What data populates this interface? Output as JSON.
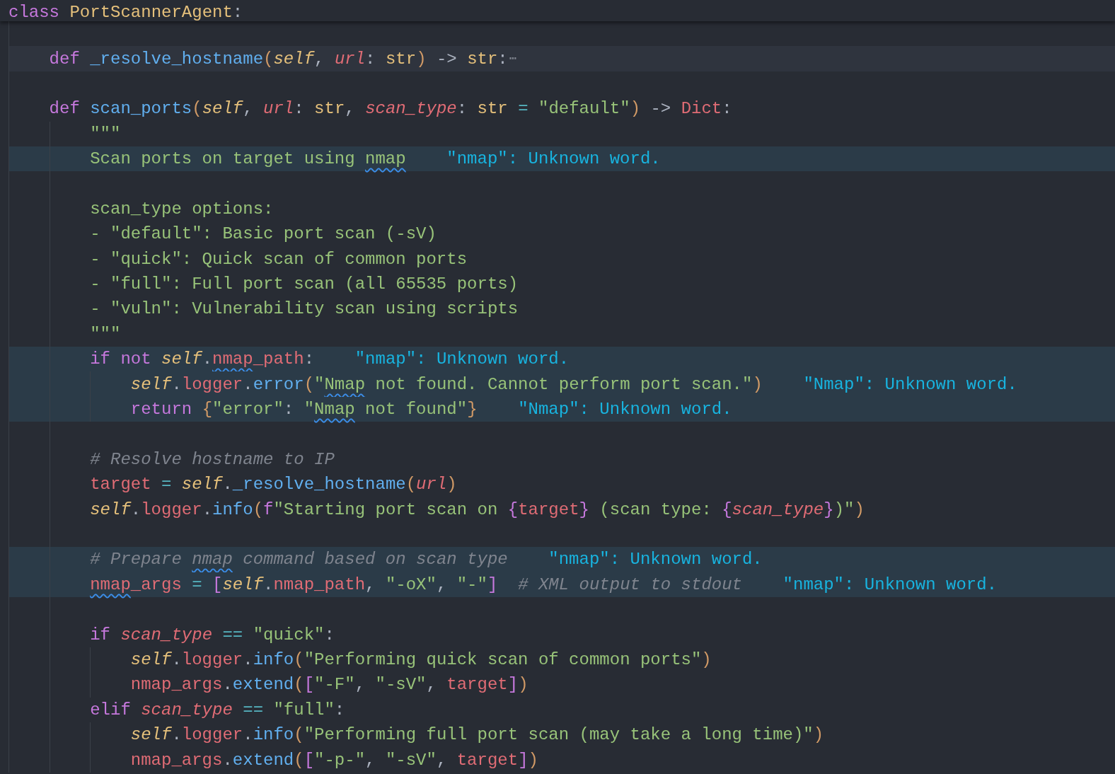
{
  "sticky_header": {
    "tokens": [
      {
        "text": "class ",
        "kind": "kw"
      },
      {
        "text": "PortScannerAgent",
        "kind": "type"
      },
      {
        "text": ":",
        "kind": "punct"
      }
    ]
  },
  "lines": [
    {
      "kind": "blank"
    },
    {
      "kind": "code",
      "folded": true,
      "tokens": [
        {
          "text": "def ",
          "kind": "kw"
        },
        {
          "text": "_resolve_hostname",
          "kind": "fn"
        },
        {
          "text": "(",
          "kind": "p1"
        },
        {
          "text": "self",
          "kind": "self"
        },
        {
          "text": ", ",
          "kind": "punct"
        },
        {
          "text": "url",
          "kind": "param"
        },
        {
          "text": ": ",
          "kind": "punct"
        },
        {
          "text": "str",
          "kind": "type"
        },
        {
          "text": ")",
          "kind": "p1"
        },
        {
          "text": " -> ",
          "kind": "punct"
        },
        {
          "text": "str",
          "kind": "type"
        },
        {
          "text": ":",
          "kind": "punct"
        }
      ],
      "fold_marker": "⋯"
    },
    {
      "kind": "blank"
    },
    {
      "kind": "code",
      "tokens": [
        {
          "text": "def ",
          "kind": "kw"
        },
        {
          "text": "scan_ports",
          "kind": "fn"
        },
        {
          "text": "(",
          "kind": "p1"
        },
        {
          "text": "self",
          "kind": "self"
        },
        {
          "text": ", ",
          "kind": "punct"
        },
        {
          "text": "url",
          "kind": "param"
        },
        {
          "text": ": ",
          "kind": "punct"
        },
        {
          "text": "str",
          "kind": "type"
        },
        {
          "text": ", ",
          "kind": "punct"
        },
        {
          "text": "scan_type",
          "kind": "param"
        },
        {
          "text": ": ",
          "kind": "punct"
        },
        {
          "text": "str",
          "kind": "type"
        },
        {
          "text": " = ",
          "kind": "op"
        },
        {
          "text": "\"default\"",
          "kind": "str"
        },
        {
          "text": ")",
          "kind": "p1"
        },
        {
          "text": " -> ",
          "kind": "punct"
        },
        {
          "text": "Dict",
          "kind": "var"
        },
        {
          "text": ":",
          "kind": "punct"
        }
      ],
      "children": [
        {
          "kind": "code",
          "tokens": [
            {
              "text": "\"\"\"",
              "kind": "str"
            }
          ]
        },
        {
          "kind": "code",
          "tokens": [
            {
              "text": "Scan ports on target using ",
              "kind": "str"
            },
            {
              "text": "nmap",
              "kind": "str",
              "misspelled": true
            }
          ],
          "diagnostic": "\"nmap\": Unknown word."
        },
        {
          "kind": "blank"
        },
        {
          "kind": "code",
          "tokens": [
            {
              "text": "scan_type options:",
              "kind": "str"
            }
          ]
        },
        {
          "kind": "code",
          "tokens": [
            {
              "text": "- \"default\": Basic port scan (-sV)",
              "kind": "str"
            }
          ]
        },
        {
          "kind": "code",
          "tokens": [
            {
              "text": "- \"quick\": Quick scan of common ports",
              "kind": "str"
            }
          ]
        },
        {
          "kind": "code",
          "tokens": [
            {
              "text": "- \"full\": Full port scan (all 65535 ports)",
              "kind": "str"
            }
          ]
        },
        {
          "kind": "code",
          "tokens": [
            {
              "text": "- \"vuln\": Vulnerability scan using scripts",
              "kind": "str"
            }
          ]
        },
        {
          "kind": "code",
          "tokens": [
            {
              "text": "\"\"\"",
              "kind": "str"
            }
          ]
        },
        {
          "kind": "code",
          "tokens": [
            {
              "text": "if ",
              "kind": "kw"
            },
            {
              "text": "not ",
              "kind": "kw"
            },
            {
              "text": "self",
              "kind": "self"
            },
            {
              "text": ".",
              "kind": "punct"
            },
            {
              "text": "nmap",
              "kind": "var",
              "misspelled": true
            },
            {
              "text": "_path",
              "kind": "var"
            },
            {
              "text": ":",
              "kind": "punct"
            }
          ],
          "diagnostic": "\"nmap\": Unknown word.",
          "children": [
            {
              "kind": "code",
              "tokens": [
                {
                  "text": "self",
                  "kind": "self"
                },
                {
                  "text": ".",
                  "kind": "punct"
                },
                {
                  "text": "logger",
                  "kind": "var"
                },
                {
                  "text": ".",
                  "kind": "punct"
                },
                {
                  "text": "error",
                  "kind": "fn"
                },
                {
                  "text": "(",
                  "kind": "p1"
                },
                {
                  "text": "\"",
                  "kind": "str"
                },
                {
                  "text": "Nmap",
                  "kind": "str",
                  "misspelled": true
                },
                {
                  "text": " not found. Cannot perform port scan.\"",
                  "kind": "str"
                },
                {
                  "text": ")",
                  "kind": "p1"
                }
              ],
              "diagnostic": "\"Nmap\": Unknown word."
            },
            {
              "kind": "code",
              "tokens": [
                {
                  "text": "return ",
                  "kind": "kw"
                },
                {
                  "text": "{",
                  "kind": "p1"
                },
                {
                  "text": "\"error\"",
                  "kind": "str"
                },
                {
                  "text": ": ",
                  "kind": "punct"
                },
                {
                  "text": "\"",
                  "kind": "str"
                },
                {
                  "text": "Nmap",
                  "kind": "str",
                  "misspelled": true
                },
                {
                  "text": " not found\"",
                  "kind": "str"
                },
                {
                  "text": "}",
                  "kind": "p1"
                }
              ],
              "diagnostic": "\"Nmap\": Unknown word."
            }
          ]
        },
        {
          "kind": "blank"
        },
        {
          "kind": "code",
          "tokens": [
            {
              "text": "# Resolve hostname to IP",
              "kind": "comment"
            }
          ]
        },
        {
          "kind": "code",
          "tokens": [
            {
              "text": "target",
              "kind": "var"
            },
            {
              "text": " = ",
              "kind": "op"
            },
            {
              "text": "self",
              "kind": "self"
            },
            {
              "text": ".",
              "kind": "punct"
            },
            {
              "text": "_resolve_hostname",
              "kind": "fn"
            },
            {
              "text": "(",
              "kind": "p1"
            },
            {
              "text": "url",
              "kind": "param"
            },
            {
              "text": ")",
              "kind": "p1"
            }
          ]
        },
        {
          "kind": "code",
          "tokens": [
            {
              "text": "self",
              "kind": "self"
            },
            {
              "text": ".",
              "kind": "punct"
            },
            {
              "text": "logger",
              "kind": "var"
            },
            {
              "text": ".",
              "kind": "punct"
            },
            {
              "text": "info",
              "kind": "fn"
            },
            {
              "text": "(",
              "kind": "p1"
            },
            {
              "text": "f",
              "kind": "kw"
            },
            {
              "text": "\"Starting port scan on ",
              "kind": "str"
            },
            {
              "text": "{",
              "kind": "p2"
            },
            {
              "text": "target",
              "kind": "var"
            },
            {
              "text": "}",
              "kind": "p2"
            },
            {
              "text": " (scan type: ",
              "kind": "str"
            },
            {
              "text": "{",
              "kind": "p2"
            },
            {
              "text": "scan_type",
              "kind": "param"
            },
            {
              "text": "}",
              "kind": "p2"
            },
            {
              "text": ")\"",
              "kind": "str"
            },
            {
              "text": ")",
              "kind": "p1"
            }
          ]
        },
        {
          "kind": "blank"
        },
        {
          "kind": "code",
          "tokens": [
            {
              "text": "# Prepare ",
              "kind": "comment"
            },
            {
              "text": "nmap",
              "kind": "comment",
              "misspelled": true
            },
            {
              "text": " command based on scan type",
              "kind": "comment"
            }
          ],
          "diagnostic": "\"nmap\": Unknown word."
        },
        {
          "kind": "code",
          "tokens": [
            {
              "text": "nmap",
              "kind": "var",
              "misspelled": true
            },
            {
              "text": "_args",
              "kind": "var"
            },
            {
              "text": " = ",
              "kind": "op"
            },
            {
              "text": "[",
              "kind": "p2"
            },
            {
              "text": "self",
              "kind": "self"
            },
            {
              "text": ".",
              "kind": "punct"
            },
            {
              "text": "nmap_path",
              "kind": "var"
            },
            {
              "text": ", ",
              "kind": "punct"
            },
            {
              "text": "\"-oX\"",
              "kind": "str"
            },
            {
              "text": ", ",
              "kind": "punct"
            },
            {
              "text": "\"-\"",
              "kind": "str"
            },
            {
              "text": "]",
              "kind": "p2"
            },
            {
              "text": "  # XML output to stdout",
              "kind": "comment"
            }
          ],
          "diagnostic": "\"nmap\": Unknown word."
        },
        {
          "kind": "blank"
        },
        {
          "kind": "code",
          "tokens": [
            {
              "text": "if ",
              "kind": "kw"
            },
            {
              "text": "scan_type",
              "kind": "param"
            },
            {
              "text": " == ",
              "kind": "op"
            },
            {
              "text": "\"quick\"",
              "kind": "str"
            },
            {
              "text": ":",
              "kind": "punct"
            }
          ],
          "children": [
            {
              "kind": "code",
              "tokens": [
                {
                  "text": "self",
                  "kind": "self"
                },
                {
                  "text": ".",
                  "kind": "punct"
                },
                {
                  "text": "logger",
                  "kind": "var"
                },
                {
                  "text": ".",
                  "kind": "punct"
                },
                {
                  "text": "info",
                  "kind": "fn"
                },
                {
                  "text": "(",
                  "kind": "p1"
                },
                {
                  "text": "\"Performing quick scan of common ports\"",
                  "kind": "str"
                },
                {
                  "text": ")",
                  "kind": "p1"
                }
              ]
            },
            {
              "kind": "code",
              "tokens": [
                {
                  "text": "nmap_args",
                  "kind": "var"
                },
                {
                  "text": ".",
                  "kind": "punct"
                },
                {
                  "text": "extend",
                  "kind": "fn"
                },
                {
                  "text": "(",
                  "kind": "p1"
                },
                {
                  "text": "[",
                  "kind": "p2"
                },
                {
                  "text": "\"-F\"",
                  "kind": "str"
                },
                {
                  "text": ", ",
                  "kind": "punct"
                },
                {
                  "text": "\"-sV\"",
                  "kind": "str"
                },
                {
                  "text": ", ",
                  "kind": "punct"
                },
                {
                  "text": "target",
                  "kind": "var"
                },
                {
                  "text": "]",
                  "kind": "p2"
                },
                {
                  "text": ")",
                  "kind": "p1"
                }
              ]
            }
          ]
        },
        {
          "kind": "code",
          "tokens": [
            {
              "text": "elif ",
              "kind": "kw"
            },
            {
              "text": "scan_type",
              "kind": "param"
            },
            {
              "text": " == ",
              "kind": "op"
            },
            {
              "text": "\"full\"",
              "kind": "str"
            },
            {
              "text": ":",
              "kind": "punct"
            }
          ],
          "children": [
            {
              "kind": "code",
              "tokens": [
                {
                  "text": "self",
                  "kind": "self"
                },
                {
                  "text": ".",
                  "kind": "punct"
                },
                {
                  "text": "logger",
                  "kind": "var"
                },
                {
                  "text": ".",
                  "kind": "punct"
                },
                {
                  "text": "info",
                  "kind": "fn"
                },
                {
                  "text": "(",
                  "kind": "p1"
                },
                {
                  "text": "\"Performing full port scan (may take a long time)\"",
                  "kind": "str"
                },
                {
                  "text": ")",
                  "kind": "p1"
                }
              ]
            },
            {
              "kind": "code",
              "tokens": [
                {
                  "text": "nmap_args",
                  "kind": "var"
                },
                {
                  "text": ".",
                  "kind": "punct"
                },
                {
                  "text": "extend",
                  "kind": "fn"
                },
                {
                  "text": "(",
                  "kind": "p1"
                },
                {
                  "text": "[",
                  "kind": "p2"
                },
                {
                  "text": "\"-p-\"",
                  "kind": "str"
                },
                {
                  "text": ", ",
                  "kind": "punct"
                },
                {
                  "text": "\"-sV\"",
                  "kind": "str"
                },
                {
                  "text": ", ",
                  "kind": "punct"
                },
                {
                  "text": "target",
                  "kind": "var"
                },
                {
                  "text": "]",
                  "kind": "p2"
                },
                {
                  "text": ")",
                  "kind": "p1"
                }
              ]
            }
          ]
        }
      ]
    }
  ]
}
